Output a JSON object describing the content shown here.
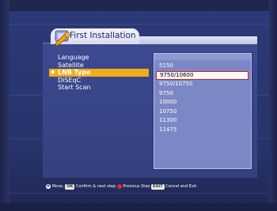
{
  "header": {
    "title": "First Installation"
  },
  "menu": {
    "items": [
      {
        "label": "Language",
        "selected": false
      },
      {
        "label": "Satellite",
        "selected": false
      },
      {
        "label": "LNB Type",
        "selected": true
      },
      {
        "label": "DiSEqC",
        "selected": false
      },
      {
        "label": "Start Scan",
        "selected": false
      }
    ]
  },
  "dropdown": {
    "options": [
      "5150",
      "9750/10600",
      "9750/10750",
      "9750",
      "10000",
      "10750",
      "11300",
      "11475"
    ],
    "selected_index": 1
  },
  "help_bar": {
    "move_label": "Move,",
    "ok_key": "OK",
    "ok_label": "Confirm & next step",
    "prev_label": "Previous Step",
    "exit_key": "EXIT",
    "exit_label": "Cancel and Exit"
  },
  "colors": {
    "accent": "#f0ad1c",
    "background": "#2d3a79",
    "panel": "#3d4a91",
    "dropdown": "#7c88c6",
    "selection_border": "#c1272d"
  }
}
